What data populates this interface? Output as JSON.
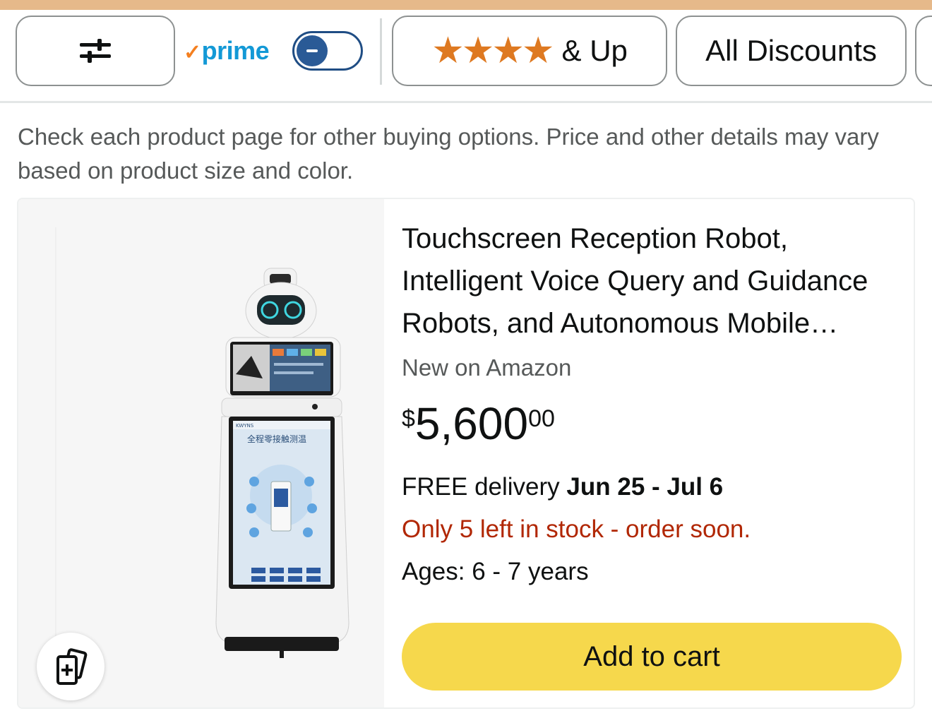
{
  "filters": {
    "filter_icon": "sliders-icon",
    "prime_logo_check": "✓",
    "prime_logo_text": "prime",
    "prime_toggle_state": "off",
    "stars_label": "& Up",
    "stars_count": 4,
    "star_color": "#de7921",
    "discount_label": "All Discounts"
  },
  "notice": "Check each product page for other buying options. Price and other details may vary based on product size and color.",
  "product": {
    "title": "Touchscreen Reception Robot, Intelligent Voice Query and Guidance Robots, and Autonomous Mobile Robots for Business",
    "badge": "New on Amazon",
    "price_symbol": "$",
    "price_whole": "5,600",
    "price_fraction": "00",
    "delivery_prefix": "FREE delivery ",
    "delivery_dates": "Jun 25 - Jul 6",
    "stock_text": "Only 5 left in stock - order soon.",
    "stock_color": "#b12704",
    "ages": "Ages: 6 - 7 years",
    "add_to_cart": "Add to cart",
    "add_to_cart_color": "#f6d84c",
    "compare_icon": "compare-icon",
    "robot_screen_text": "全程零接触测温",
    "robot_brand": "KWYNS"
  }
}
